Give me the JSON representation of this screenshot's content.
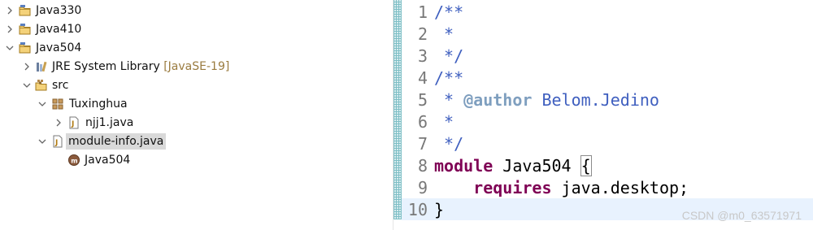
{
  "explorer": {
    "items": [
      {
        "label": "Java330",
        "expanded": false,
        "icon": "java-project-icon"
      },
      {
        "label": "Java410",
        "expanded": false,
        "icon": "java-project-icon"
      },
      {
        "label": "Java504",
        "expanded": true,
        "icon": "java-project-icon"
      },
      {
        "label": "JRE System Library",
        "decorator": "[JavaSE-19]",
        "expanded": false,
        "icon": "library-icon"
      },
      {
        "label": "src",
        "expanded": true,
        "icon": "source-folder-icon"
      },
      {
        "label": "Tuxinghua",
        "expanded": true,
        "icon": "package-icon"
      },
      {
        "label": "njj1.java",
        "expanded": false,
        "icon": "java-file-icon"
      },
      {
        "label": "module-info.java",
        "expanded": true,
        "icon": "java-file-icon",
        "selected": true
      },
      {
        "label": "Java504",
        "icon": "module-icon"
      }
    ]
  },
  "editor": {
    "line_numbers": [
      "1",
      "2",
      "3",
      "4",
      "5",
      "6",
      "7",
      "8",
      "9",
      "10"
    ],
    "lines": {
      "l1": "/**",
      "l2": " *",
      "l3": " */",
      "l4": "/**",
      "l5_prefix": " * ",
      "l5_tag": "@author",
      "l5_text": " Belom.Jedino",
      "l6": " *",
      "l7": " */",
      "l8_kw": "module",
      "l8_text": " Java504 ",
      "l8_brace": "{",
      "l9_indent": "    ",
      "l9_kw": "requires",
      "l9_text": " java.desktop;",
      "l10": "}"
    },
    "current_line": "10"
  },
  "watermark": "CSDN @m0_63571971",
  "colors": {
    "comment": "#3f5fbf",
    "javadoc_tag": "#7f9fbf",
    "keyword": "#7f0055",
    "current_line": "#e8f2fe",
    "selection": "#d9d9d9"
  }
}
